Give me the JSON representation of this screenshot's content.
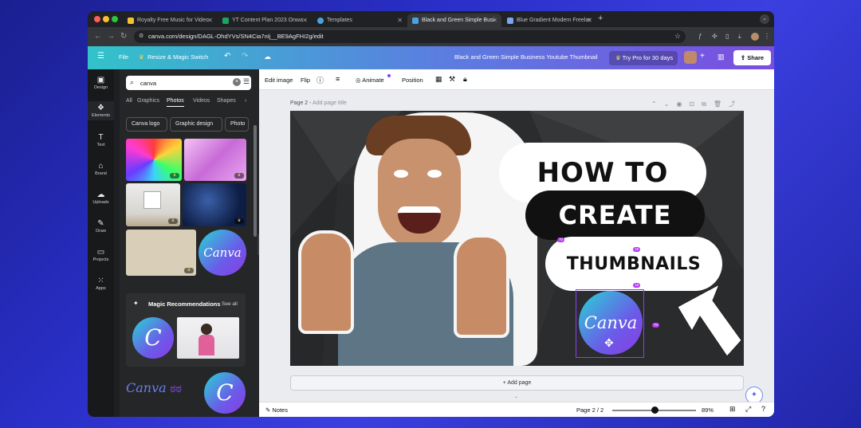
{
  "browser": {
    "tabs": [
      {
        "title": "Royalty Free Music for Video",
        "active": false
      },
      {
        "title": "YT Content Plan 2023 Onwa",
        "active": false
      },
      {
        "title": "Templates",
        "active": false
      },
      {
        "title": "Black and Green Simple Busi",
        "active": true
      },
      {
        "title": "Blue Gradient Modern Freelar",
        "active": false
      }
    ],
    "url": "canva.com/design/DAGL-OhdYVs/SN4Cia7nIj__BE9AgFHI2g/edit"
  },
  "header": {
    "menu_icon": "hamburger-icon",
    "file_label": "File",
    "resize_label": "Resize & Magic Switch",
    "doc_title": "Black and Green Simple Business Youtube Thumbnail",
    "pro_label": "Try Pro for 30 days",
    "share_label": "Share"
  },
  "rail": {
    "items": [
      {
        "label": "Design",
        "icon": "design-icon"
      },
      {
        "label": "Elements",
        "icon": "elements-icon",
        "active": true
      },
      {
        "label": "Text",
        "icon": "text-icon"
      },
      {
        "label": "Brand",
        "icon": "brand-icon"
      },
      {
        "label": "Uploads",
        "icon": "uploads-icon"
      },
      {
        "label": "Draw",
        "icon": "draw-icon"
      },
      {
        "label": "Projects",
        "icon": "projects-icon"
      },
      {
        "label": "Apps",
        "icon": "apps-icon"
      }
    ]
  },
  "panel": {
    "search_value": "canva",
    "categories": [
      "All",
      "Graphics",
      "Photos",
      "Videos",
      "Shapes"
    ],
    "active_category": "Photos",
    "chips": [
      "Canva logo",
      "Graphic design",
      "Photo"
    ],
    "magic_title": "Magic Recommendations",
    "see_all": "See all",
    "logo_text": "Canva",
    "logo_initial": "C"
  },
  "toolbar": {
    "edit_image": "Edit image",
    "flip": "Flip",
    "animate": "Animate",
    "position": "Position"
  },
  "page": {
    "label": "Page 2",
    "add_title": "Add page title",
    "add_page": "+ Add page"
  },
  "canvas": {
    "line1": "HOW TO",
    "line2": "CREATE",
    "line3": "THUMBNAILS",
    "logo_text": "Canva",
    "tag_a": "70",
    "tag_b": "19",
    "tag_c": "19",
    "tag_d": "70"
  },
  "status": {
    "notes": "Notes",
    "page_count": "Page 2 / 2",
    "zoom": "89%",
    "zoom_level": 0.5
  },
  "colors": {
    "canva_cyan": "#32c3c9",
    "canva_purple": "#7a4de0",
    "selection": "#8b3dff"
  }
}
